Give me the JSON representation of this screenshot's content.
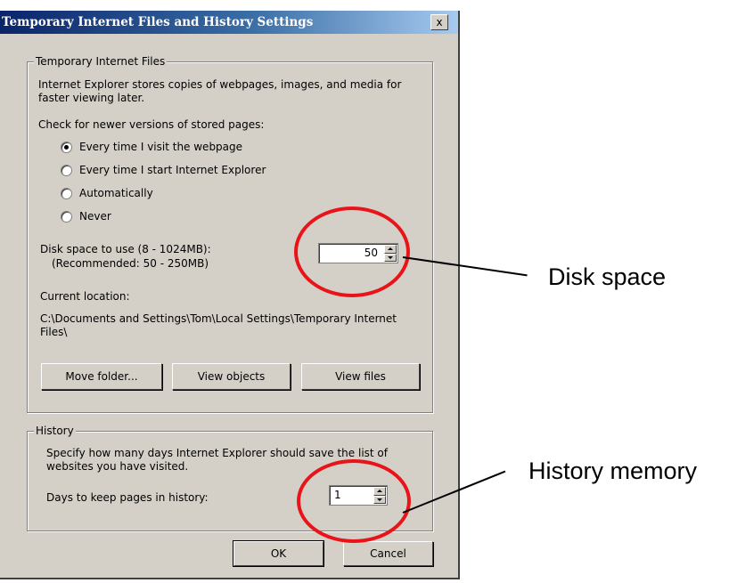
{
  "dialog": {
    "title": "Temporary Internet Files and History Settings",
    "close_glyph": "x"
  },
  "temp_files": {
    "legend": "Temporary Internet Files",
    "description": "Internet Explorer stores copies of webpages, images, and media for faster viewing later.",
    "check_label": "Check for newer versions of stored pages:",
    "options": [
      {
        "label": "Every time I visit the webpage",
        "selected": true
      },
      {
        "label": "Every time I start Internet Explorer",
        "selected": false
      },
      {
        "label": "Automatically",
        "selected": false
      },
      {
        "label": "Never",
        "selected": false
      }
    ],
    "disk_label": "Disk space to use (8 - 1024MB):",
    "disk_recommended": "(Recommended: 50 - 250MB)",
    "disk_value": "50",
    "location_label": "Current location:",
    "location_path": "C:\\Documents and Settings\\Tom\\Local Settings\\Temporary Internet Files\\",
    "buttons": {
      "move_folder": "Move folder...",
      "view_objects": "View objects",
      "view_files": "View files"
    }
  },
  "history": {
    "legend": "History",
    "description": "Specify how many days Internet Explorer should save the list of websites you have visited.",
    "days_label": "Days to keep pages in history:",
    "days_value": "1"
  },
  "footer": {
    "ok": "OK",
    "cancel": "Cancel"
  },
  "annotations": {
    "disk_space": "Disk space",
    "history_memory": "History memory",
    "circle_color": "#e8141a"
  }
}
